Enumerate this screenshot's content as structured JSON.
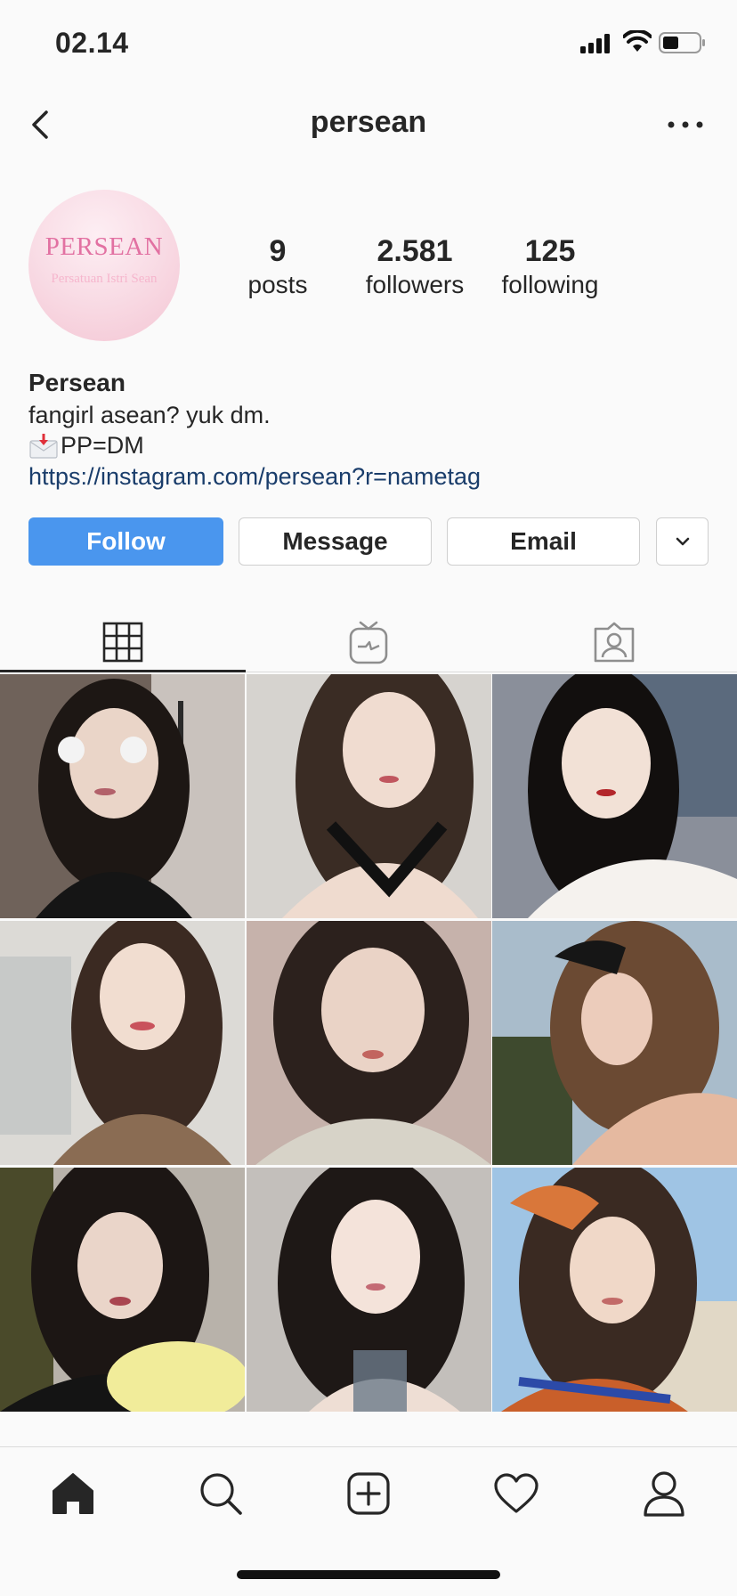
{
  "status_bar": {
    "time": "02.14",
    "icons": [
      "signal-icon",
      "wifi-icon",
      "battery-icon"
    ]
  },
  "header": {
    "username": "persean",
    "back_icon": "chevron-left-icon",
    "more_icon": "more-horizontal-icon"
  },
  "profile": {
    "avatar_brand": "PERSEAN",
    "avatar_subtitle": "Persatuan Istri Sean",
    "stats": [
      {
        "value": "9",
        "label": "posts"
      },
      {
        "value": "2.581",
        "label": "followers"
      },
      {
        "value": "125",
        "label": "following"
      }
    ],
    "name": "Persean",
    "bio_line1": "fangirl asean? yuk dm.",
    "bio_line2": "PP=DM",
    "bio_line2_icon": "envelope-with-arrow-icon",
    "link": "https://instagram.com/persean?r=nametag"
  },
  "actions": {
    "follow": "Follow",
    "message": "Message",
    "email": "Email",
    "dropdown_icon": "chevron-down-icon"
  },
  "tabs": [
    {
      "name": "grid",
      "icon": "grid-icon",
      "active": true
    },
    {
      "name": "igtv",
      "icon": "igtv-icon",
      "active": false
    },
    {
      "name": "tagged",
      "icon": "tagged-person-icon",
      "active": false
    }
  ],
  "posts_count_visible": 9,
  "bottom_nav": [
    {
      "name": "home",
      "icon": "home-icon",
      "active": true
    },
    {
      "name": "search",
      "icon": "search-icon"
    },
    {
      "name": "new-post",
      "icon": "plus-square-icon"
    },
    {
      "name": "activity",
      "icon": "heart-icon"
    },
    {
      "name": "profile",
      "icon": "profile-icon"
    }
  ],
  "colors": {
    "follow_button": "#4a96ee",
    "link": "#1a3d6b",
    "avatar_pink": "#f4c5d3",
    "brand_text": "#e271a2"
  }
}
